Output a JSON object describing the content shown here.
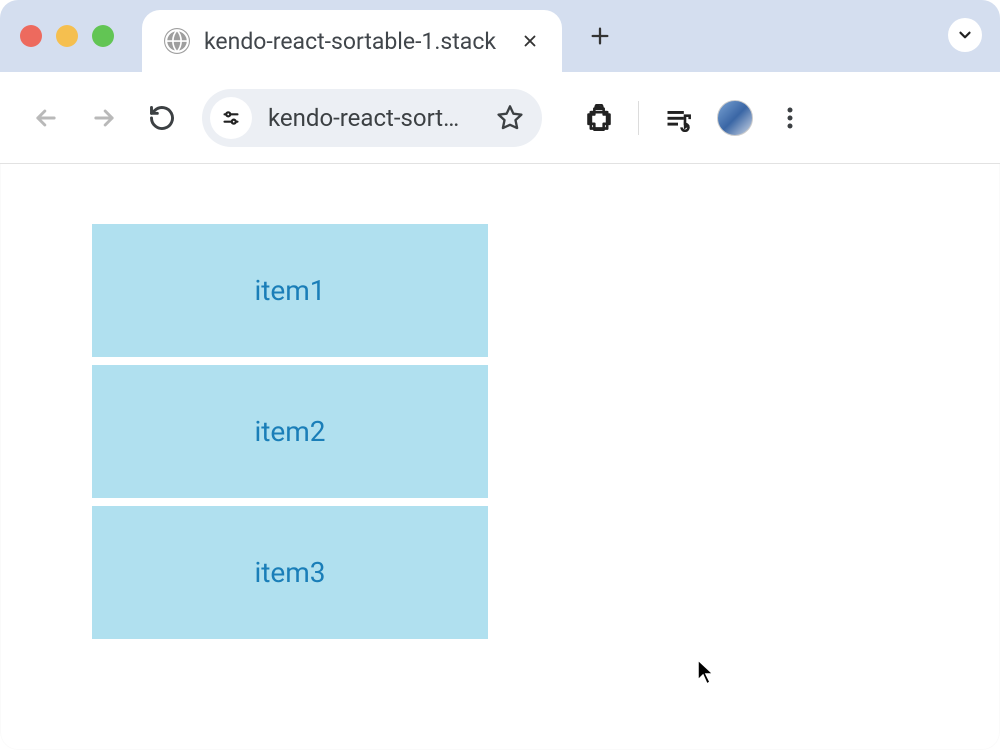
{
  "tab": {
    "title": "kendo-react-sortable-1.stack"
  },
  "url": "kendo-react-sort…",
  "sortable": {
    "items": [
      "item1",
      "item2",
      "item3"
    ]
  },
  "colors": {
    "tab_bar": "#d4deef",
    "item_bg": "#b0e0ef",
    "item_fg": "#1a7eb8"
  }
}
